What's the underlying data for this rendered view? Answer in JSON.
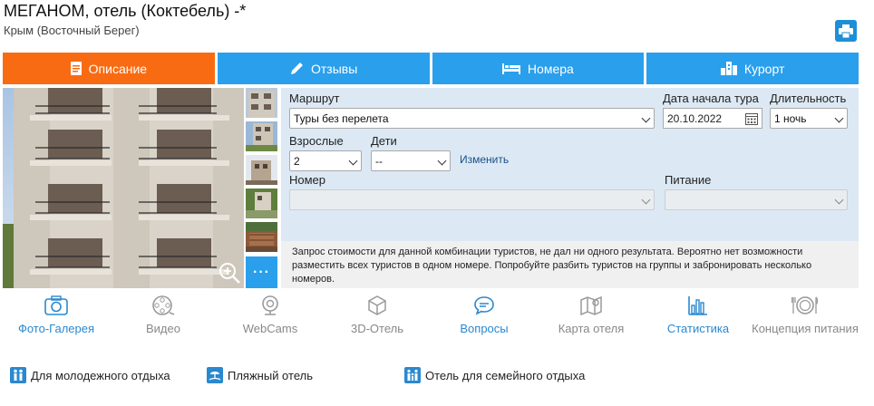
{
  "hotel": {
    "title": "МЕГАНОМ, отель (Коктебель) -*",
    "location": "Крым (Восточный Берег)"
  },
  "tabs": [
    {
      "label": "Описание",
      "icon": "document-icon",
      "active": true
    },
    {
      "label": "Отзывы",
      "icon": "pen-icon",
      "active": false
    },
    {
      "label": "Номера",
      "icon": "bed-icon",
      "active": false
    },
    {
      "label": "Курорт",
      "icon": "city-icon",
      "active": false
    }
  ],
  "gallery": {
    "more_label": "···"
  },
  "form": {
    "route_label": "Маршрут",
    "route_value": "Туры без перелета",
    "date_label": "Дата начала тура",
    "date_value": "20.10.2022",
    "duration_label": "Длительность",
    "duration_value": "1 ночь",
    "adults_label": "Взрослые",
    "adults_value": "2",
    "children_label": "Дети",
    "children_value": "--",
    "change_link": "Изменить",
    "room_label": "Номер",
    "room_value": "",
    "meal_label": "Питание",
    "meal_value": "",
    "notice": "Запрос стоимости для данной комбинации туристов, не дал ни одного результата. Вероятно нет возможности разместить всех туристов в одном номере. Попробуйте разбить туристов на группы и забронировать несколько номеров."
  },
  "features": [
    {
      "label": "Фото-Галерея",
      "icon": "camera-icon",
      "enabled": true
    },
    {
      "label": "Видео",
      "icon": "film-reel-icon",
      "enabled": false
    },
    {
      "label": "WebCams",
      "icon": "webcam-icon",
      "enabled": false
    },
    {
      "label": "3D-Отель",
      "icon": "3d-cube-icon",
      "enabled": false
    },
    {
      "label": "Вопросы",
      "icon": "chat-bubble-icon",
      "enabled": true
    },
    {
      "label": "Карта отеля",
      "icon": "map-icon",
      "enabled": false
    },
    {
      "label": "Статистика",
      "icon": "bar-chart-icon",
      "enabled": true
    },
    {
      "label": "Концепция питания",
      "icon": "plate-icon",
      "enabled": false
    }
  ],
  "tags": [
    {
      "label": "Для молодежного отдыха",
      "icon": "youth-icon"
    },
    {
      "label": "Пляжный отель",
      "icon": "beach-icon"
    },
    {
      "label": "Отель для семейного отдыха",
      "icon": "family-icon"
    }
  ],
  "colors": {
    "accent_blue": "#2a9fec",
    "active_orange": "#f96b12",
    "form_bg": "#dce9f4",
    "feature_blue": "#2a88d0"
  }
}
